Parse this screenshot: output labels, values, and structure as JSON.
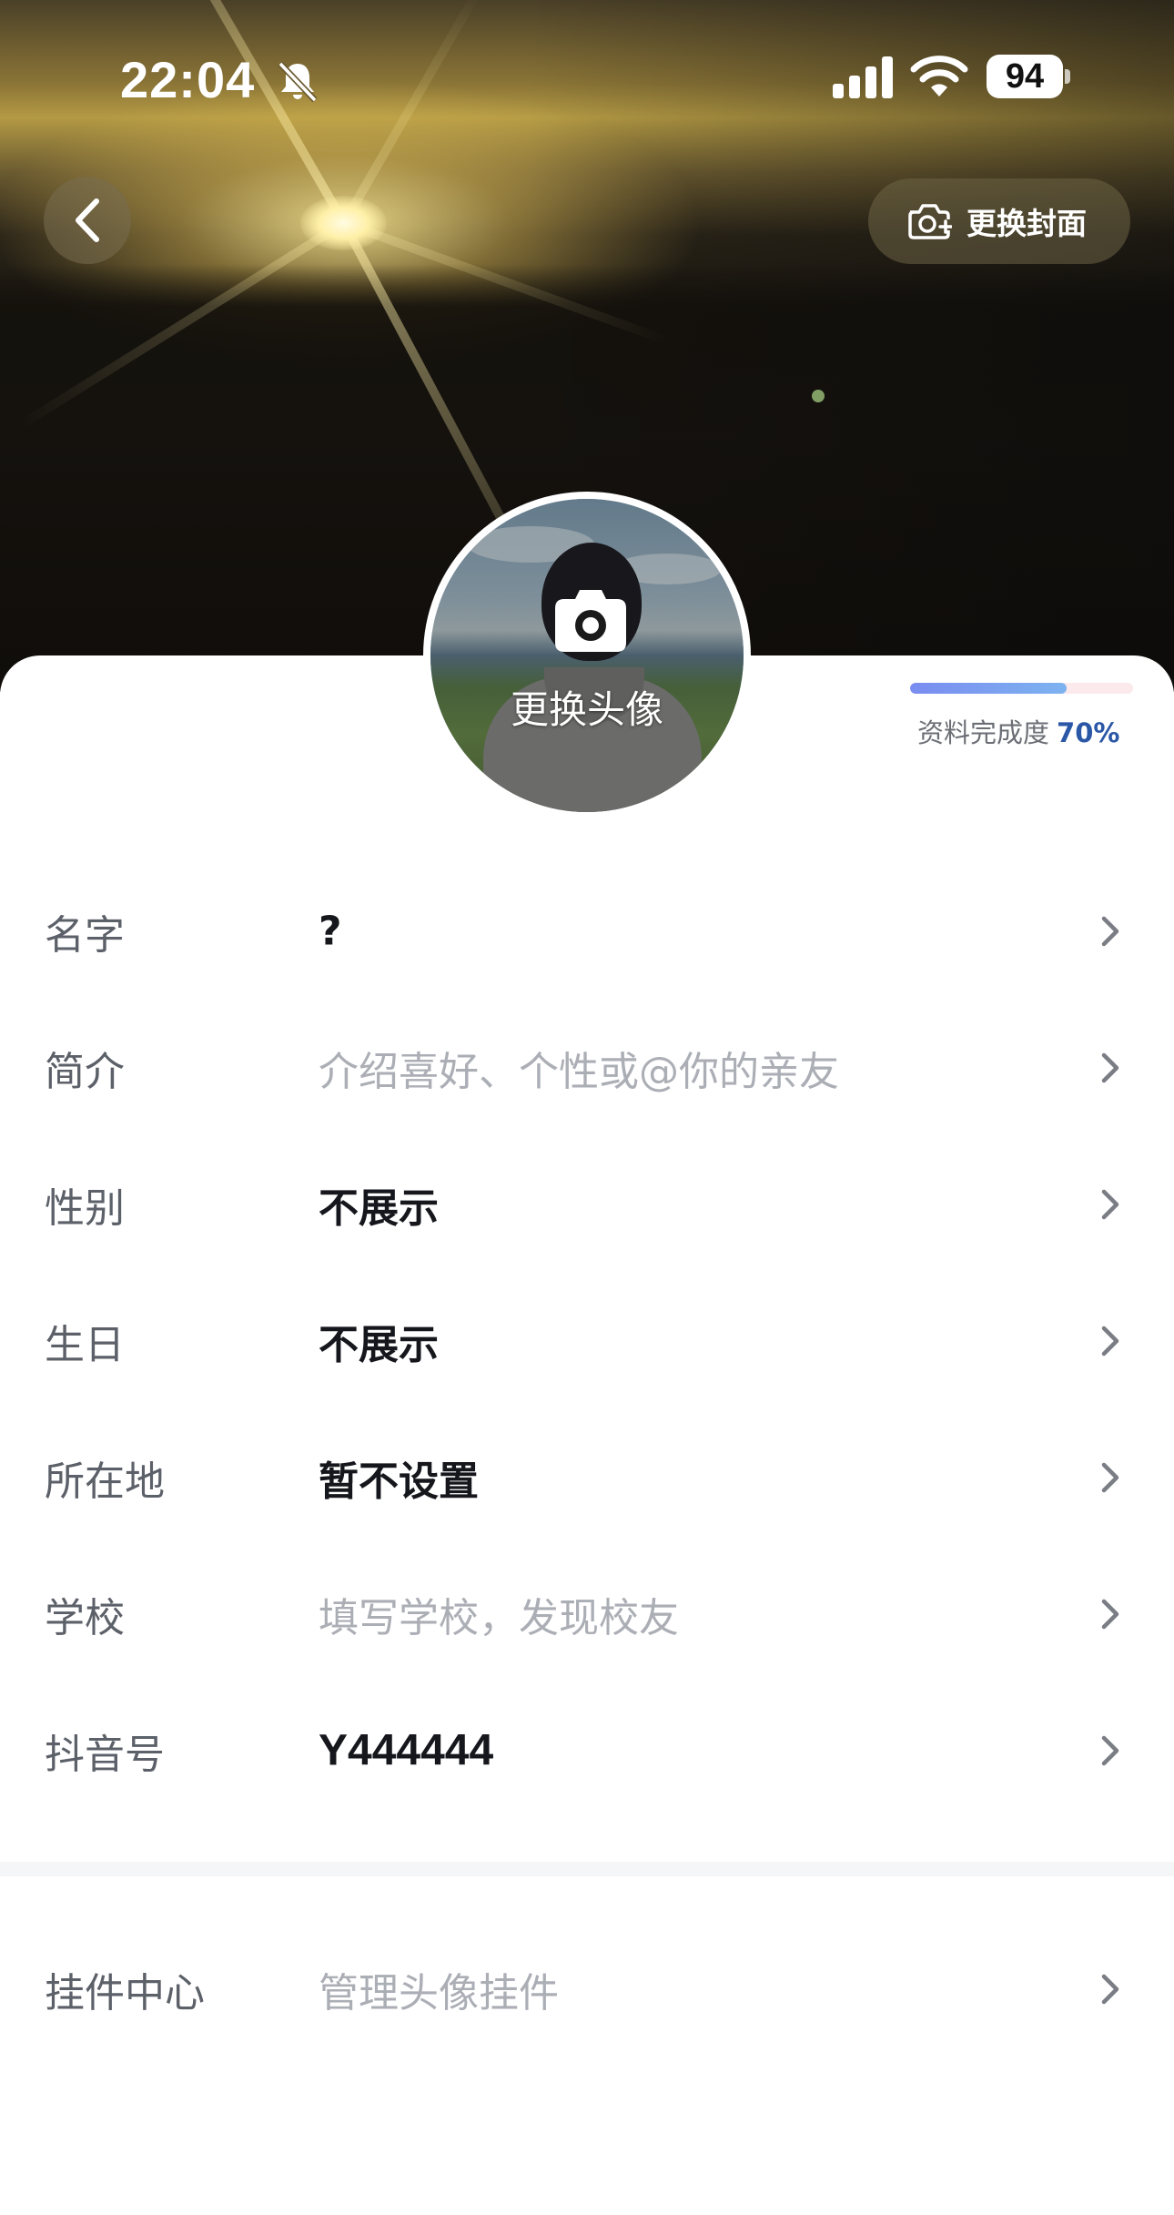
{
  "status_bar": {
    "time": "22:04",
    "battery": "94"
  },
  "header": {
    "change_cover_label": "更换封面"
  },
  "avatar": {
    "change_label": "更换头像"
  },
  "completeness": {
    "label": "资料完成度",
    "percent_text": "70%",
    "fraction": 0.7
  },
  "profile_rows": [
    {
      "label": "名字",
      "value": "?",
      "style": "strong"
    },
    {
      "label": "简介",
      "value": "介绍喜好、个性或@你的亲友",
      "style": "placeholder"
    },
    {
      "label": "性别",
      "value": "不展示",
      "style": "strong"
    },
    {
      "label": "生日",
      "value": "不展示",
      "style": "strong"
    },
    {
      "label": "所在地",
      "value": "暂不设置",
      "style": "strong"
    },
    {
      "label": "学校",
      "value": "填写学校，发现校友",
      "style": "placeholder"
    },
    {
      "label": "抖音号",
      "value": "Y444444",
      "style": "strong"
    }
  ],
  "extra_row": {
    "label": "挂件中心",
    "value": "管理头像挂件",
    "style": "placeholder"
  },
  "icons": [
    "bell-slash-icon",
    "signal-icon",
    "wifi-icon",
    "battery-icon",
    "back-chevron-icon",
    "camera-plus-icon",
    "camera-icon",
    "chevron-right-icon"
  ],
  "colors": {
    "progress_fill": "#7a8cf0",
    "progress_track": "#fbe9ec",
    "percent_accent": "#2a57a6",
    "label_gray": "#5c6068",
    "placeholder_gray": "#abaeb5",
    "value_dark": "#15171c"
  }
}
